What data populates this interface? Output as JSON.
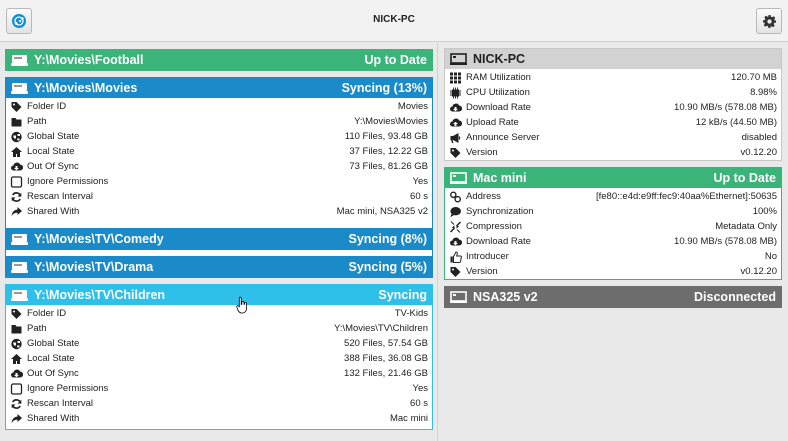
{
  "header": {
    "title": "NICK-PC"
  },
  "folders": [
    {
      "name": "Y:\\Movies\\Football",
      "status": "Up to Date"
    },
    {
      "name": "Y:\\Movies\\Movies",
      "status": "Syncing (13%)",
      "details": [
        {
          "icon": "tag-icon",
          "label": "Folder ID",
          "value": "Movies"
        },
        {
          "icon": "folder-icon",
          "label": "Path",
          "value": "Y:\\Movies\\Movies"
        },
        {
          "icon": "globe-icon",
          "label": "Global State",
          "value": "110 Files, 93.48 GB"
        },
        {
          "icon": "home-icon",
          "label": "Local State",
          "value": "37 Files, 12.22 GB"
        },
        {
          "icon": "cloud-download-icon",
          "label": "Out Of Sync",
          "value": "73 Files, 81.26 GB"
        },
        {
          "icon": "checkbox-icon",
          "label": "Ignore Permissions",
          "value": "Yes"
        },
        {
          "icon": "refresh-icon",
          "label": "Rescan Interval",
          "value": "60 s"
        },
        {
          "icon": "share-icon",
          "label": "Shared With",
          "value": "Mac mini, NSA325 v2"
        }
      ]
    },
    {
      "name": "Y:\\Movies\\TV\\Comedy",
      "status": "Syncing (8%)"
    },
    {
      "name": "Y:\\Movies\\TV\\Drama",
      "status": "Syncing (5%)"
    },
    {
      "name": "Y:\\Movies\\TV\\Children",
      "status": "Syncing",
      "details": [
        {
          "icon": "tag-icon",
          "label": "Folder ID",
          "value": "TV-Kids"
        },
        {
          "icon": "folder-icon",
          "label": "Path",
          "value": "Y:\\Movies\\TV\\Children"
        },
        {
          "icon": "globe-icon",
          "label": "Global State",
          "value": "520 Files, 57.54 GB"
        },
        {
          "icon": "home-icon",
          "label": "Local State",
          "value": "388 Files, 36.08 GB"
        },
        {
          "icon": "cloud-download-icon",
          "label": "Out Of Sync",
          "value": "132 Files, 21.46 GB"
        },
        {
          "icon": "checkbox-icon",
          "label": "Ignore Permissions",
          "value": "Yes"
        },
        {
          "icon": "refresh-icon",
          "label": "Rescan Interval",
          "value": "60 s"
        },
        {
          "icon": "share-icon",
          "label": "Shared With",
          "value": "Mac mini"
        }
      ]
    }
  ],
  "this_device": {
    "name": "NICK-PC",
    "details": [
      {
        "icon": "ram-icon",
        "label": "RAM Utilization",
        "value": "120.70 MB"
      },
      {
        "icon": "cpu-icon",
        "label": "CPU Utilization",
        "value": "8.98%"
      },
      {
        "icon": "cloud-download-icon",
        "label": "Download Rate",
        "value": "10.90 MB/s (578.08 MB)"
      },
      {
        "icon": "cloud-upload-icon",
        "label": "Upload Rate",
        "value": "12 kB/s (44.50 MB)"
      },
      {
        "icon": "bullhorn-icon",
        "label": "Announce Server",
        "value": "disabled"
      },
      {
        "icon": "tag-icon",
        "label": "Version",
        "value": "v0.12.20"
      }
    ]
  },
  "devices": [
    {
      "name": "Mac mini",
      "status": "Up to Date",
      "details": [
        {
          "icon": "link-icon",
          "label": "Address",
          "value": "[fe80::e4d:e9ff:fec9:40aa%Ethernet]:50635"
        },
        {
          "icon": "comment-icon",
          "label": "Synchronization",
          "value": "100%"
        },
        {
          "icon": "compress-icon",
          "label": "Compression",
          "value": "Metadata Only"
        },
        {
          "icon": "cloud-download-icon",
          "label": "Download Rate",
          "value": "10.90 MB/s (578.08 MB)"
        },
        {
          "icon": "thumbs-up-icon",
          "label": "Introducer",
          "value": "No"
        },
        {
          "icon": "tag-icon",
          "label": "Version",
          "value": "v0.12.20"
        }
      ]
    },
    {
      "name": "NSA325 v2",
      "status": "Disconnected"
    }
  ],
  "colors": {
    "up_to_date": "#3bb47a",
    "syncing": "#1a8ac9",
    "syncing_hover": "#2fc0ea",
    "disconnected": "#6d6d6d",
    "local_device": "#d2d2d2"
  }
}
